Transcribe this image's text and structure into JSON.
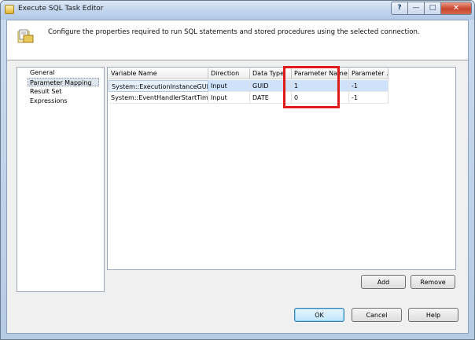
{
  "window": {
    "title": "Execute SQL Task Editor",
    "help_glyph": "?",
    "minimize_glyph": "—",
    "maximize_glyph": "□",
    "close_glyph": "✕"
  },
  "header": {
    "description": "Configure the properties required to run SQL statements and stored procedures using the selected connection."
  },
  "nav": {
    "items": [
      {
        "label": "General"
      },
      {
        "label": "Parameter Mapping",
        "selected": true
      },
      {
        "label": "Result Set"
      },
      {
        "label": "Expressions"
      }
    ]
  },
  "grid": {
    "columns": [
      "Variable Name",
      "Direction",
      "Data Type",
      "Parameter Name",
      "Parameter ..."
    ],
    "rows": [
      [
        "System::ExecutionInstanceGUID",
        "Input",
        "GUID",
        "1",
        "-1"
      ],
      [
        "System::EventHandlerStartTime",
        "Input",
        "DATE",
        "0",
        "-1"
      ]
    ]
  },
  "buttons": {
    "add": "Add",
    "remove": "Remove",
    "ok": "OK",
    "cancel": "Cancel",
    "help": "Help"
  },
  "colors": {
    "highlight_border": "#e11a1a",
    "selected_row": "#cfe2fb"
  }
}
